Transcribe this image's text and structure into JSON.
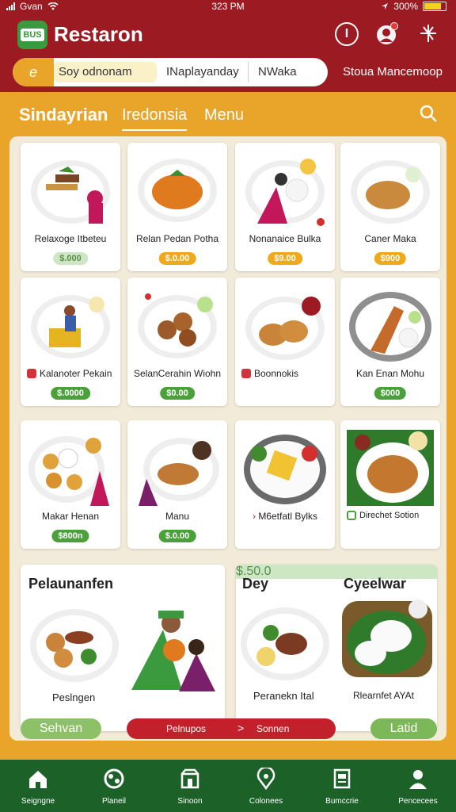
{
  "status": {
    "carrier": "Gvan",
    "time": "323 PM",
    "battery": "300%"
  },
  "header": {
    "logo_text": "BUS",
    "title": "Restaron",
    "info_icon": "I",
    "search": {
      "lead": "e",
      "segments": [
        "Soy odnonam",
        "INaplayanday",
        "NWaka"
      ]
    },
    "store_link": "Stoua Mancemoop"
  },
  "section": {
    "title": "Sindayrian",
    "tab1": "Iredonsia",
    "tab2": "Menu"
  },
  "cards": [
    {
      "name": "Relaxoge Itbeteu",
      "price": "$.000"
    },
    {
      "name": "Relan Pedan Potha",
      "price": "$.0.00"
    },
    {
      "name": "Nonanaice Bulka",
      "price": "$9.00"
    },
    {
      "name": "Caner Maka",
      "price": "$900"
    },
    {
      "name": "Kalanoter Pekain",
      "price": "$.0000"
    },
    {
      "name": "SelanCerahin Wiohn",
      "price": "$0.00"
    },
    {
      "name": "Boonnokis",
      "price": ""
    },
    {
      "name": "Kan Enan Mohu",
      "price": "$000"
    },
    {
      "name": "Makar Henan",
      "price": "$800n"
    },
    {
      "name": "Manu",
      "price": "$.0.00"
    },
    {
      "name": "M6etfatl Bylks",
      "price": ""
    },
    {
      "name": "Direchet Sotion",
      "price": ""
    }
  ],
  "featured": {
    "left": {
      "title": "Pelaunanfen",
      "name": "Peslngen"
    },
    "right": {
      "title": "Dey",
      "title2": "Cyeelwar",
      "name1": "Peranekn Ital",
      "price1": "$.50.0",
      "name2": "Rlearnfet AYAt"
    }
  },
  "actions": {
    "left": "Sehvan",
    "right": "Latid",
    "nav_left": "Pelnupos",
    "nav_arrow": ">",
    "nav_right": "Sonnen"
  },
  "bottomnav": [
    "Seigngne",
    "Planeil",
    "Sinoon",
    "Colonees",
    "Bumccrie",
    "Pencecees"
  ],
  "colors": {
    "primary_red": "#9c1b22",
    "accent_orange": "#e9a42a",
    "green": "#4aa13a",
    "nav_green": "#1c6128"
  }
}
